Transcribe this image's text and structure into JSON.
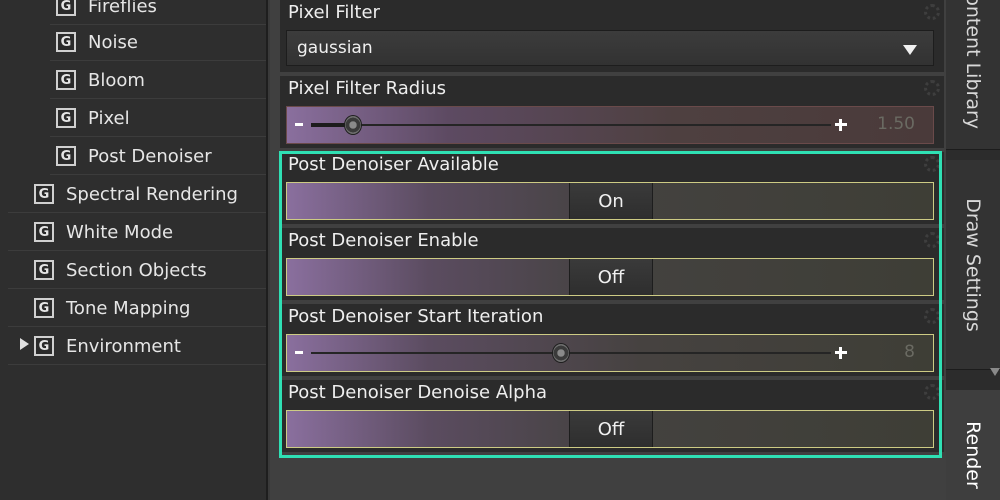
{
  "tree": {
    "sub_items": [
      {
        "label": "Fireflies",
        "icon": "G"
      },
      {
        "label": "Noise",
        "icon": "G"
      },
      {
        "label": "Bloom",
        "icon": "G"
      },
      {
        "label": "Pixel",
        "icon": "G"
      },
      {
        "label": "Post Denoiser",
        "icon": "G"
      }
    ],
    "top_items": [
      {
        "label": "Spectral Rendering",
        "icon": "G"
      },
      {
        "label": "White Mode",
        "icon": "G"
      },
      {
        "label": "Section Objects",
        "icon": "G"
      },
      {
        "label": "Tone Mapping",
        "icon": "G"
      },
      {
        "label": "Environment",
        "icon": "G",
        "expandable": true
      }
    ]
  },
  "properties": {
    "pixel_filter": {
      "label": "Pixel Filter",
      "value": "gaussian"
    },
    "pixel_filter_radius": {
      "label": "Pixel Filter Radius",
      "value": "1.50",
      "fraction": 0.08
    },
    "post_denoiser_available": {
      "label": "Post Denoiser Available",
      "value": "On"
    },
    "post_denoiser_enable": {
      "label": "Post Denoiser Enable",
      "value": "Off"
    },
    "post_denoiser_start_iteration": {
      "label": "Post Denoiser Start Iteration",
      "value": "8",
      "fraction": 0.48
    },
    "post_denoiser_denoise_alpha": {
      "label": "Post Denoiser Denoise Alpha",
      "value": "Off"
    }
  },
  "tabs": [
    {
      "label": "Content Library",
      "active": false
    },
    {
      "label": "Draw Settings",
      "active": false
    },
    {
      "label": "Render",
      "active": true
    }
  ],
  "colors": {
    "highlight": "#2fe0b4",
    "accent_gradient_start": "#8a6f9e",
    "linked_border": "#cdcb84"
  },
  "icons": [
    "g-group-icon",
    "expand-arrow-icon",
    "dropdown-arrow-icon",
    "gear-icon",
    "minus-icon",
    "plus-icon",
    "slider-knob"
  ]
}
